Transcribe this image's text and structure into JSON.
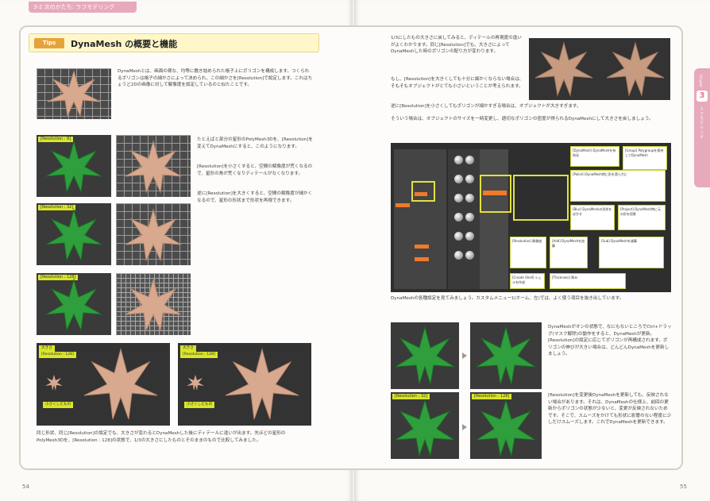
{
  "header": {
    "chapter": "3-2 次のかたち: ラフモデリング"
  },
  "tips": {
    "badge": "Tips",
    "title": "DynaMesh の概要と機能"
  },
  "left": {
    "p1": "DynaMeshとは、画面の様な、均等に敷き詰められた格子上にポリゴンを構成します。つくられるポリゴンは格子の細かさによって決められ、この細かさを[Resolution]で設定します。これはちょうど2Dの画像に対して解像度を設定しているのと似たことです。",
    "p2": "たとえばと部分の星形のPolyMesh3Dを、[Resolution]を変えてDynaMeshにすると、このようになります。",
    "p3": "[Resolution]を小さくすると、空間の解像度が荒くなるので、星形の角が荒くなりディテールがなくなります。",
    "p4": "逆に[Resolution]を大きくすると、空間の解像度が細かくなるので、星形の形状まで形状を再現できます。",
    "p5": "同じ形状、同じ[Resolution]の設定でも、大きさが変わるとDynaMeshした後にディテールに違いが出ます。先ほどの星形のPolyMesh3Dを、[Resolution : 128]の状態で、1/3の大きさにしたものとそのままのもので比較してみました。",
    "labels": [
      "[Resolution : 8]",
      "[Resolution : 32]",
      "[Resolution : 128]"
    ],
    "small_label": "小さくしたもの",
    "res_label": "[Resolution : 128]",
    "captions": [
      "大きさ",
      "大きさ"
    ],
    "page_no": "54"
  },
  "right": {
    "p1": "1/3にしたもの大きさに戻してみると、ディテールの再現度の違いがよくわかります。同じ[Resolution]でも、大きさによってDynaMeshした時のポリゴンの配り方が変わります。",
    "p2": "もし、[Resolution]を大きくしても十分に細かくならない場合は、そもそもオブジェクトがとても小さいということが考えられます。",
    "p3": "逆に[Resolution]を小さくしてもポリゴンが細かすぎる場合は、オブジェクトが大きすぎます。",
    "p4": "そういう場合は、オブジェクトのサイズを一時変更し、適切なポリゴンの密度が得られるDynaMeshにして大きさを戻しましょう。",
    "caption_ui": "DynaMeshの各種設定を見てみましょう。カスタムメニュー1(ホーム、左)では、よく使う項目を抜き出しています。",
    "notes": [
      "[DynaMesh] DynaMeshを有効化",
      "[Group] Polygroupを保持してDynaMesh",
      "[Polish] DynaMesh時に形を滑らかに",
      "[Blur] DynaMeshの形状をぼかす",
      "[Project] DynaMesh時に元の形を投影",
      "[Resolution] 解像度",
      "[Add] DynaMeshを加算",
      "[Sub] DynaMeshを減算",
      "[Create Shell] シェルを作成",
      "[Thickness] 厚み"
    ],
    "p5": "DynaMeshがオンの状態で、なにもないところでCtrl+ドラッグ(マスク解除)の動作をすると、DynaMeshが更新。[Resolution]の設定に応じてポリゴンが再構成されます。ポリゴンの伸びが大きい場合は、どんどんDynaMeshを更新しましょう。",
    "p6": "[Resolution]を変更後DynaMeshを更新しても、反映されない場合があります。それは、DynaMeshの仕様上、前回の更新からポリゴンの状態が少ないと、変更が反映されないためです。そこで、スムーズをかけても形状に影響のない程度に少しだけスムーズします。これでDynaMeshを更新できます。",
    "res_label": "[Resolution : 32]",
    "res_label2": "[Resolution : 128]",
    "side_num": "3",
    "side_text": "ラフモデリング",
    "side_small": "Chapter",
    "page_no": "55"
  }
}
